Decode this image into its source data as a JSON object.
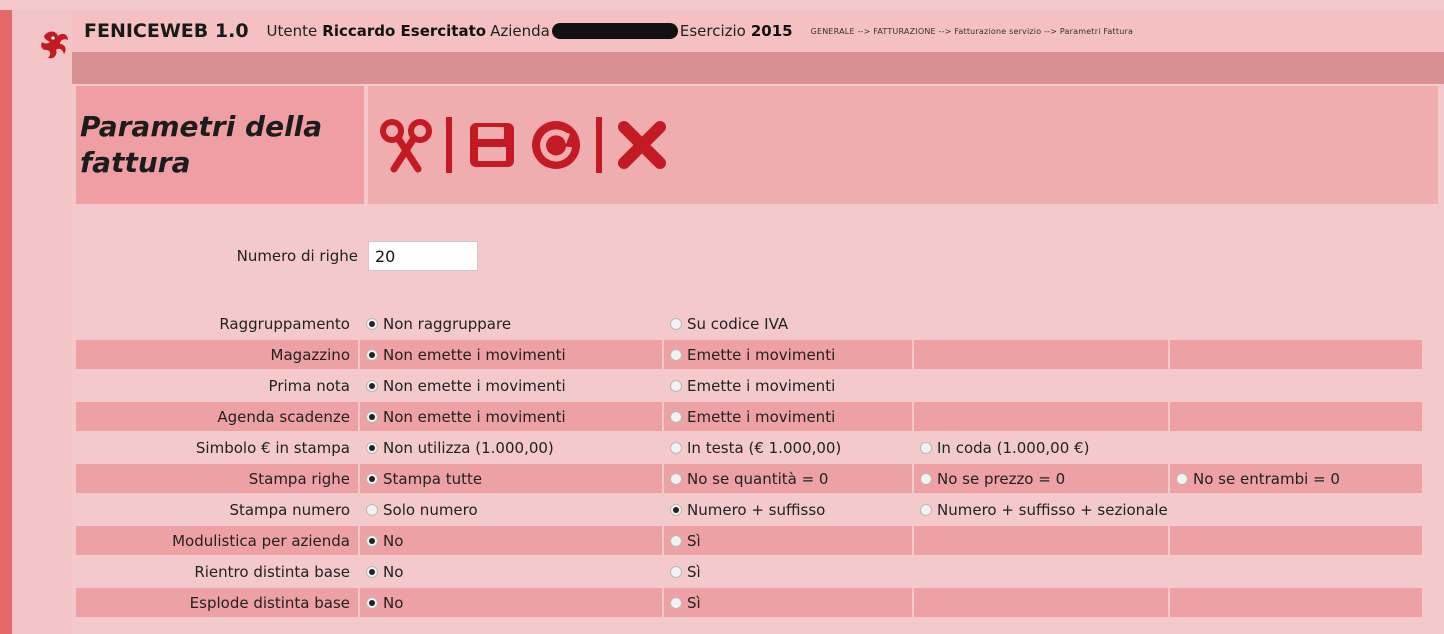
{
  "header": {
    "app_name": "FENICEWEB 1.0",
    "user_label": "Utente",
    "user_name": "Riccardo Esercitato",
    "company_label": "Azienda",
    "year_label": "Esercizio",
    "year": "2015",
    "breadcrumb": "GENERALE --> FATTURAZIONE --> Fatturazione servizio --> Parametri Fattura"
  },
  "page": {
    "title": "Parametri della fattura"
  },
  "toolbar": {
    "icons": [
      "scissors-icon",
      "save-icon",
      "refresh-icon",
      "close-icon"
    ]
  },
  "colors": {
    "accent": "#c41a23",
    "background": "#f4c9cb",
    "row_shade": "#eea1a4"
  },
  "form": {
    "rows_label": "Numero di righe",
    "rows_value": "20",
    "options": [
      {
        "label": "Raggruppamento",
        "choices": [
          "Non raggruppare",
          "Su codice IVA"
        ],
        "selected": 0
      },
      {
        "label": "Magazzino",
        "choices": [
          "Non emette i movimenti",
          "Emette i movimenti"
        ],
        "selected": 0
      },
      {
        "label": "Prima nota",
        "choices": [
          "Non emette i movimenti",
          "Emette i movimenti"
        ],
        "selected": 0
      },
      {
        "label": "Agenda scadenze",
        "choices": [
          "Non emette i movimenti",
          "Emette i movimenti"
        ],
        "selected": 0
      },
      {
        "label": "Simbolo € in stampa",
        "choices": [
          "Non utilizza (1.000,00)",
          "In testa (€ 1.000,00)",
          "In coda (1.000,00 €)"
        ],
        "selected": 0
      },
      {
        "label": "Stampa righe",
        "choices": [
          "Stampa tutte",
          "No se quantità = 0",
          "No se prezzo = 0",
          "No se entrambi = 0"
        ],
        "selected": 0
      },
      {
        "label": "Stampa numero",
        "choices": [
          "Solo numero",
          "Numero + suffisso",
          "Numero + suffisso + sezionale"
        ],
        "selected": 1
      },
      {
        "label": "Modulistica per azienda",
        "choices": [
          "No",
          "Sì"
        ],
        "selected": 0
      },
      {
        "label": "Rientro distinta base",
        "choices": [
          "No",
          "Sì"
        ],
        "selected": 0
      },
      {
        "label": "Esplode distinta base",
        "choices": [
          "No",
          "Sì"
        ],
        "selected": 0
      }
    ]
  }
}
